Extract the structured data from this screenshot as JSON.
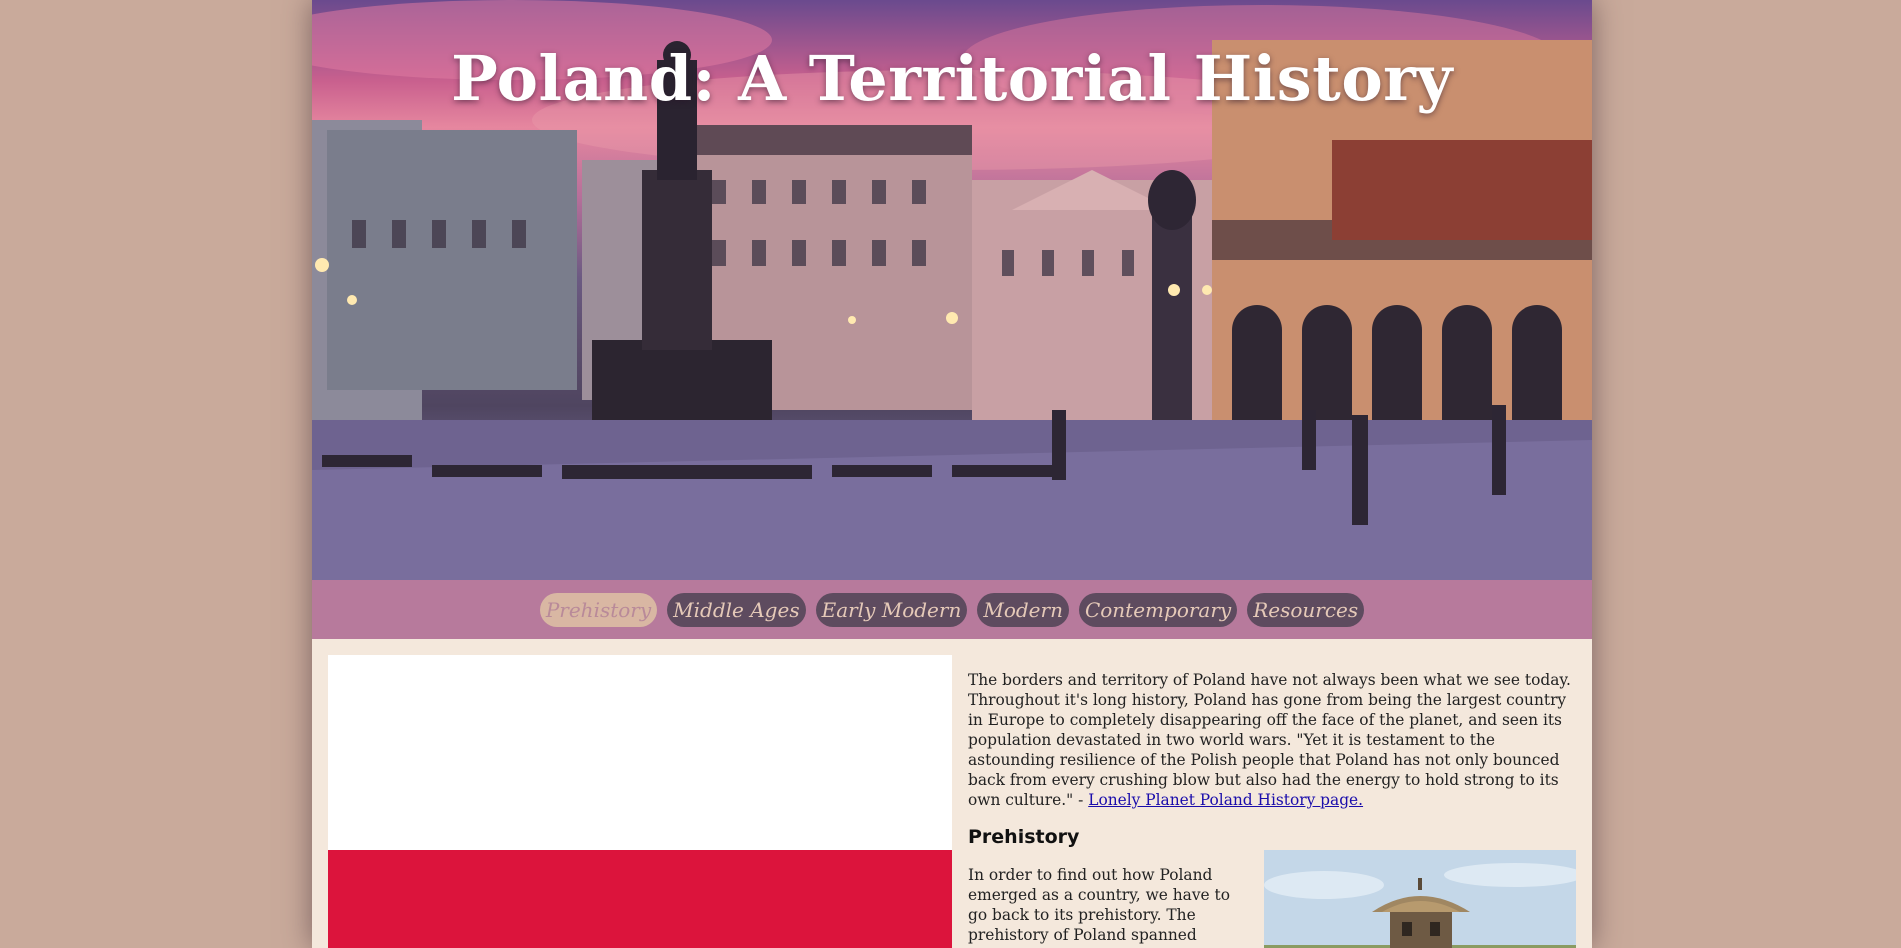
{
  "hero": {
    "title": "Poland: A Territorial History"
  },
  "nav": {
    "items": [
      {
        "label": "Prehistory",
        "active": true
      },
      {
        "label": "Middle Ages",
        "active": false
      },
      {
        "label": "Early Modern",
        "active": false
      },
      {
        "label": "Modern",
        "active": false
      },
      {
        "label": "Contemporary",
        "active": false
      },
      {
        "label": "Resources",
        "active": false
      }
    ]
  },
  "intro": {
    "text": "The borders and territory of Poland have not always been what we see today. Throughout it's long history, Poland has gone from being the largest country in Europe to completely disappearing off the face of the planet, and seen its population devastated in two world wars. \"Yet it is testament to the astounding resilience of the Polish people that Poland has not only bounced back from every crushing blow but also had the energy to hold strong to its own culture.\" - ",
    "link_text": "Lonely Planet Poland History page."
  },
  "prehistory": {
    "heading": "Prehistory",
    "text": "In order to find out how Poland emerged as a country, we have to go back to its prehistory. The prehistory of Poland spanned"
  },
  "colors": {
    "background": "#c9aa9b",
    "content_bg": "#f4e8dc",
    "nav_bar": "#b77a9c",
    "nav_pill": "#5e4b5f",
    "nav_pill_active": "#d9b7a3",
    "flag_white": "#ffffff",
    "flag_red": "#dc143c",
    "link": "#1a0dab"
  }
}
